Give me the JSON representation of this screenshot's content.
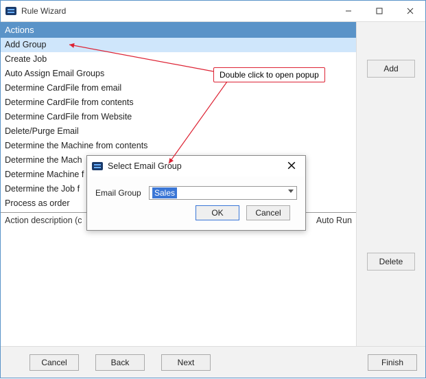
{
  "window": {
    "title": "Rule Wizard",
    "controls": {
      "min": "min",
      "max": "max",
      "close": "close"
    }
  },
  "section_header": "Actions",
  "actions": [
    "Add Group",
    "Create Job",
    "Auto Assign Email Groups",
    "Determine CardFile from email",
    "Determine CardFile from contents",
    "Determine CardFile from Website",
    "Delete/Purge Email",
    "Determine the Machine from contents",
    "Determine the Mach",
    "Determine Machine f",
    "Determine the Job f",
    "Process as order"
  ],
  "selected_action_index": 0,
  "desc_header_left": "Action description (c",
  "desc_header_right": "Auto Run",
  "side_buttons": {
    "add": "Add",
    "delete": "Delete"
  },
  "footer": {
    "cancel": "Cancel",
    "back": "Back",
    "next": "Next",
    "finish": "Finish"
  },
  "annotation": "Double click to open popup",
  "popup": {
    "title": "Select Email Group",
    "field_label": "Email Group",
    "field_value": "Sales",
    "ok": "OK",
    "cancel": "Cancel"
  }
}
